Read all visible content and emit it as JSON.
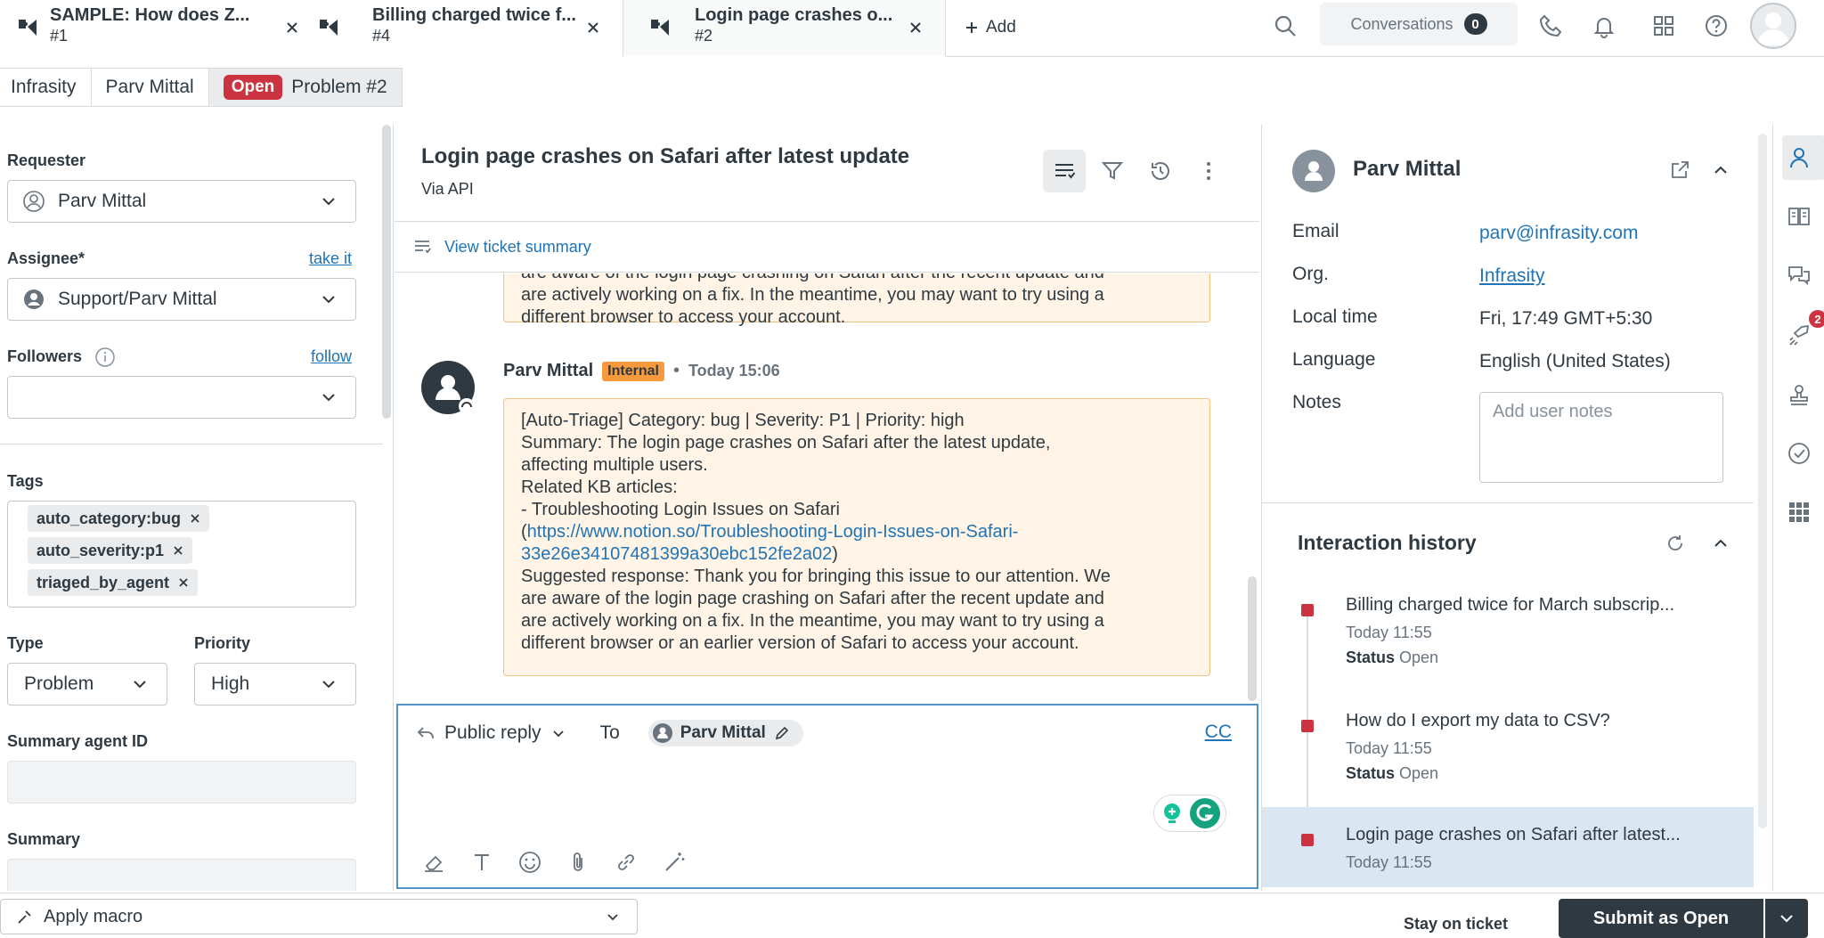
{
  "tabs": [
    {
      "title": "SAMPLE: How does Z...",
      "number": "#1"
    },
    {
      "title": "Billing charged twice f...",
      "number": "#4"
    },
    {
      "title": "Login page crashes o...",
      "number": "#2"
    }
  ],
  "topbar": {
    "add_label": "Add",
    "conversations_label": "Conversations",
    "conversations_count": "0"
  },
  "breadcrumb": {
    "org": "Infrasity",
    "requester": "Parv Mittal",
    "status": "Open",
    "ticket": "Problem #2"
  },
  "left": {
    "requester_label": "Requester",
    "requester_value": "Parv Mittal",
    "assignee_label": "Assignee*",
    "take_it": "take it",
    "assignee_value": "Support/Parv Mittal",
    "followers_label": "Followers",
    "follow": "follow",
    "tags_label": "Tags",
    "tags": [
      "auto_category:bug",
      "auto_severity:p1",
      "triaged_by_agent"
    ],
    "type_label": "Type",
    "type_value": "Problem",
    "priority_label": "Priority",
    "priority_value": "High",
    "summary_agent_label": "Summary agent ID",
    "summary_label": "Summary"
  },
  "center": {
    "title": "Login page crashes on Safari after latest update",
    "via": "Via API",
    "view_summary": "View ticket summary",
    "prev_msg_lines": [
      "are aware of the login page crashing on Safari after the recent update and",
      "are actively working on a fix. In the meantime, you may want to try using a",
      "different browser to access your account."
    ],
    "author": "Parv Mittal",
    "internal": "Internal",
    "time": "Today 15:06",
    "msg_lines": [
      "[Auto-Triage] Category: bug | Severity: P1 | Priority: high",
      "Summary: The login page crashes on Safari after the latest update,",
      "affecting multiple users.",
      "Related KB articles:",
      "- Troubleshooting Login Issues on Safari"
    ],
    "msg_link_prefix": "(",
    "msg_link_line1": "https://www.notion.so/Troubleshooting-Login-Issues-on-Safari-",
    "msg_link_line2": "33e26e34107481399a30ebc152fe2a02",
    "msg_link_suffix": ")",
    "msg_lines2": [
      "Suggested response: Thank you for bringing this issue to our attention. We",
      "are aware of the login page crashing on Safari after the recent update and",
      "are actively working on a fix. In the meantime, you may want to try using a",
      "different browser or an earlier version of Safari to access your account."
    ]
  },
  "composer": {
    "reply_type": "Public reply",
    "to_label": "To",
    "recipient": "Parv Mittal",
    "cc": "CC"
  },
  "bottom": {
    "macro": "Apply macro",
    "stay": "Stay on ticket",
    "submit_prefix": "Submit as ",
    "submit_status": "Open"
  },
  "right": {
    "name": "Parv Mittal",
    "email_label": "Email",
    "email": "parv@infrasity.com",
    "org_label": "Org.",
    "org": "Infrasity",
    "local_time_label": "Local time",
    "local_time": "Fri, 17:49 GMT+5:30",
    "language_label": "Language",
    "language": "English (United States)",
    "notes_label": "Notes",
    "notes_placeholder": "Add user notes",
    "history_title": "Interaction history",
    "history": [
      {
        "title": "Billing charged twice for March subscrip...",
        "time": "Today 11:55",
        "status_label": "Status",
        "status": "Open"
      },
      {
        "title": "How do I export my data to CSV?",
        "time": "Today 11:55",
        "status_label": "Status",
        "status": "Open"
      },
      {
        "title": "Login page crashes on Safari after latest...",
        "time": "Today 11:55"
      }
    ]
  },
  "rail_badge": "2",
  "colors": {
    "accent": "#1f73b7",
    "open_status": "#cc3340",
    "internal_note_bg": "#fff4e5",
    "internal_badge": "#f79a3e",
    "primary_button": "#2f3941"
  }
}
